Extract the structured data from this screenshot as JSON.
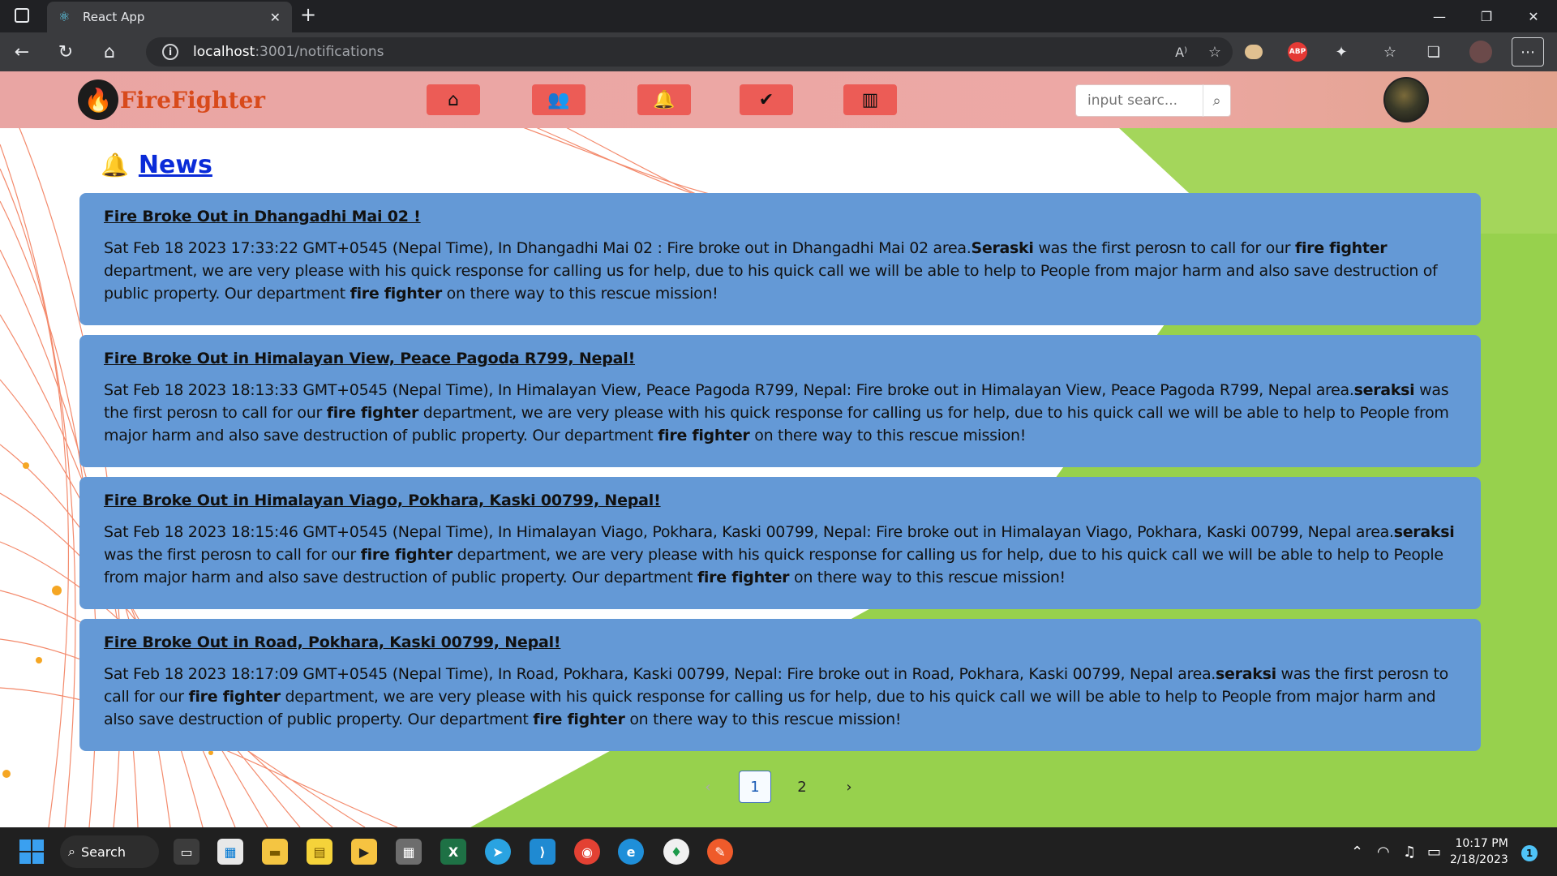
{
  "browser": {
    "tab_title": "React App",
    "url_host": "localhost",
    "url_path": ":3001/notifications",
    "read_aloud": "A⁾"
  },
  "app": {
    "brand": "FireFighter",
    "search_placeholder": "input searc...",
    "page_title": "News"
  },
  "news": [
    {
      "title": "Fire Broke Out in Dhangadhi Mai 02 !",
      "date": "Sat Feb 18 2023 17:33:22 GMT+0545 (Nepal Time), In Dhangadhi Mai 02 : Fire broke out in Dhangadhi Mai 02 area.",
      "reporter": "Seraski",
      "text_a": " was the first perosn to call for our ",
      "dept": "fire fighter",
      "text_b": " department, we are very please with his quick response for calling us for help, due to his quick call we will be able to help to People from major harm and also save destruction of public property. Our department ",
      "dept2": "fire fighter",
      "text_c": " on there way to this rescue mission!"
    },
    {
      "title": "Fire Broke Out in Himalayan View, Peace Pagoda R799, Nepal!",
      "date": "Sat Feb 18 2023 18:13:33 GMT+0545 (Nepal Time), In Himalayan View, Peace Pagoda R799, Nepal: Fire broke out in Himalayan View, Peace Pagoda R799, Nepal area.",
      "reporter": "seraksi",
      "text_a": " was the first perosn to call for our ",
      "dept": "fire fighter",
      "text_b": " department, we are very please with his quick response for calling us for help, due to his quick call we will be able to help to People from major harm and also save destruction of public property. Our department ",
      "dept2": "fire fighter",
      "text_c": " on there way to this rescue mission!"
    },
    {
      "title": "Fire Broke Out in Himalayan Viago, Pokhara, Kaski 00799, Nepal!",
      "date": "Sat Feb 18 2023 18:15:46 GMT+0545 (Nepal Time), In Himalayan Viago, Pokhara, Kaski 00799, Nepal: Fire broke out in Himalayan Viago, Pokhara, Kaski 00799, Nepal area.",
      "reporter": "seraksi",
      "text_a": " was the first perosn to call for our ",
      "dept": "fire fighter",
      "text_b": " department, we are very please with his quick response for calling us for help, due to his quick call we will be able to help to People from major harm and also save destruction of public property. Our department ",
      "dept2": "fire fighter",
      "text_c": " on there way to this rescue mission!"
    },
    {
      "title": "Fire Broke Out in Road, Pokhara, Kaski 00799, Nepal!",
      "date": "Sat Feb 18 2023 18:17:09 GMT+0545 (Nepal Time), In Road, Pokhara, Kaski 00799, Nepal: Fire broke out in Road, Pokhara, Kaski 00799, Nepal area.",
      "reporter": "seraksi",
      "text_a": " was the first perosn to call for our ",
      "dept": "fire fighter",
      "text_b": " department, we are very please with his quick response for calling us for help, due to his quick call we will be able to help to People from major harm and also save destruction of public property. Our department ",
      "dept2": "fire fighter",
      "text_c": " on there way to this rescue mission!"
    }
  ],
  "pagination": {
    "prev": "‹",
    "page1": "1",
    "page2": "2",
    "next": "›"
  },
  "taskbar": {
    "search_label": "Search",
    "time": "10:17 PM",
    "date": "2/18/2023",
    "notification_count": "1"
  }
}
